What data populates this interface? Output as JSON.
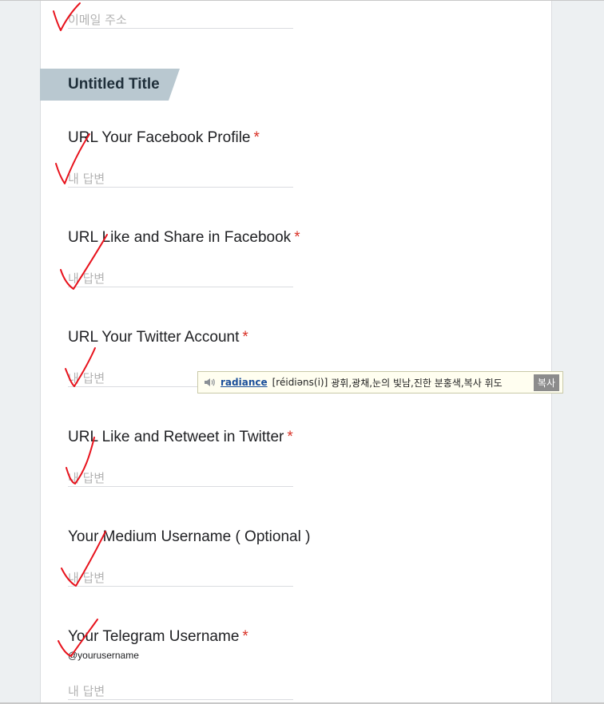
{
  "email_placeholder": "이메일 주소",
  "section": {
    "title": "Untitled Title"
  },
  "questions": [
    {
      "label": "URL Your Facebook Profile",
      "required": "*",
      "placeholder": "내 답변"
    },
    {
      "label": "URL Like and Share in Facebook",
      "required": "*",
      "placeholder": "내 답변"
    },
    {
      "label": "URL Your Twitter Account",
      "required": "*",
      "placeholder": "내 답변"
    },
    {
      "label": "URL Like and Retweet in Twitter",
      "required": "*",
      "placeholder": "내 답변"
    },
    {
      "label": "Your Medium Username ( Optional )",
      "required": "",
      "placeholder": "내 답변"
    },
    {
      "label": "Your Telegram Username",
      "required": "*",
      "helper": "@yourusername",
      "placeholder": "내 답변"
    }
  ],
  "dictionary_popup": {
    "word": "radiance",
    "pronunciation": "[réidiəns(i)]",
    "meaning": "광휘,광채,눈의 빛남,진한 분홍색,복사 휘도",
    "copy_label": "복사"
  },
  "colors": {
    "required": "#d93025",
    "section_bg": "#b9c8d0",
    "check_mark": "#e8131d"
  }
}
